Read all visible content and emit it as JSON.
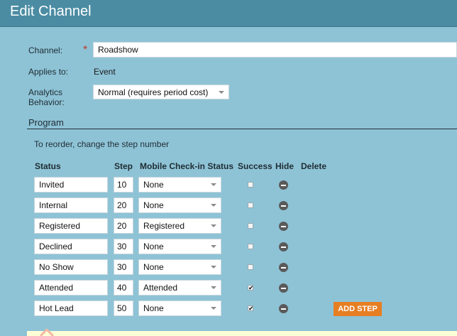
{
  "window": {
    "title": "Edit Channel"
  },
  "form": {
    "channel_label": "Channel:",
    "channel_required": "*",
    "channel_value": "Roadshow",
    "applies_to_label": "Applies to:",
    "applies_to_value": "Event",
    "analytics_label_line1": "Analytics",
    "analytics_label_line2": "Behavior:",
    "analytics_value": "Normal (requires period cost)"
  },
  "program": {
    "section_title": "Program",
    "reorder_hint": "To reorder, change the step number",
    "columns": {
      "status": "Status",
      "step": "Step",
      "mobile": "Mobile Check-in Status",
      "success": "Success",
      "hide": "Hide",
      "delete": "Delete"
    },
    "rows": [
      {
        "status": "Invited",
        "step": "10",
        "mobile": "None",
        "success": false
      },
      {
        "status": "Internal",
        "step": "20",
        "mobile": "None",
        "success": false
      },
      {
        "status": "Registered",
        "step": "20",
        "mobile": "Registered",
        "success": false
      },
      {
        "status": "Declined",
        "step": "30",
        "mobile": "None",
        "success": false
      },
      {
        "status": "No Show",
        "step": "30",
        "mobile": "None",
        "success": false
      },
      {
        "status": "Attended",
        "step": "40",
        "mobile": "Attended",
        "success": true
      },
      {
        "status": "Hot Lead",
        "step": "50",
        "mobile": "None",
        "success": true
      }
    ],
    "add_step_label": "ADD STEP"
  },
  "icons": {
    "hide": "minus-circle-icon",
    "checkmark": "✔",
    "caret": "chevron-down-icon"
  }
}
